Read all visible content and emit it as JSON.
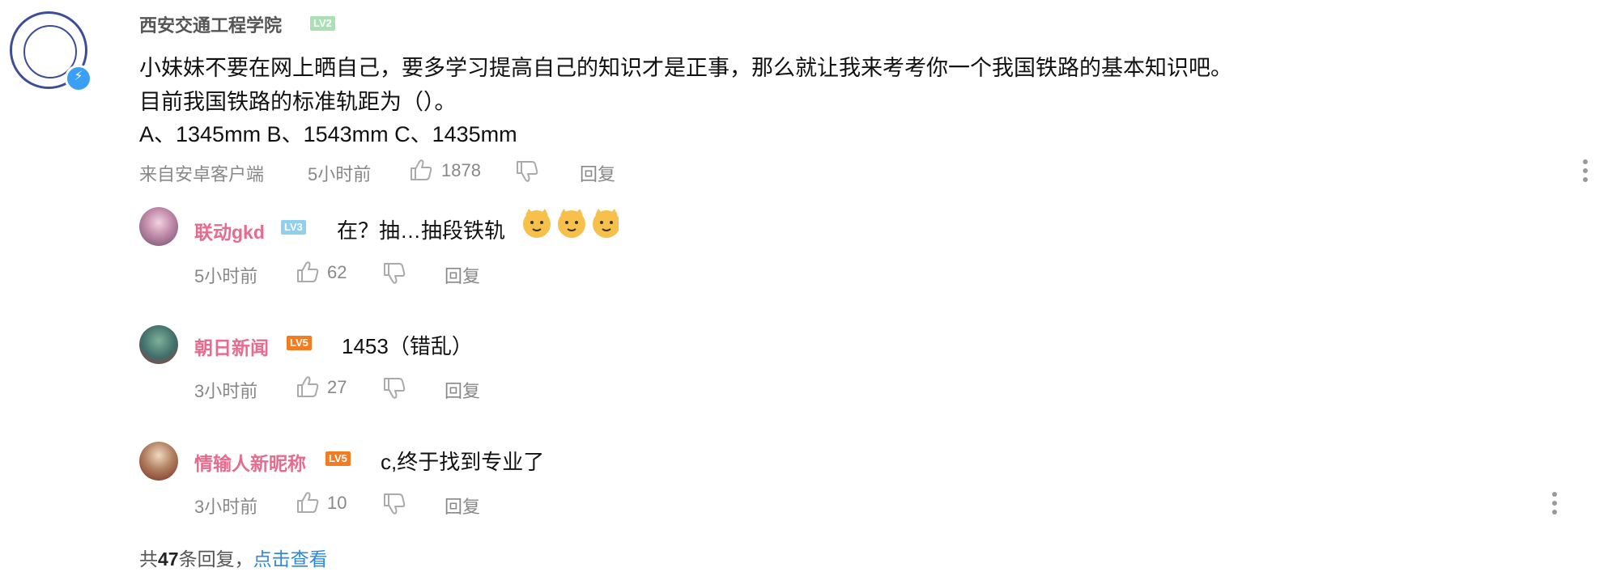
{
  "post": {
    "author": "西安交通工程学院",
    "level": "LV2",
    "lines": [
      "小妹妹不要在网上晒自己，要多学习提高自己的知识才是正事，那么就让我来考考你一个我国铁路的基本知识吧。",
      "目前我国铁路的标准轨距为（）。",
      "A、1345mm B、1543mm C、1435mm"
    ],
    "source": "来自安卓客户端",
    "time": "5小时前",
    "likes": "1878",
    "reply_label": "回复"
  },
  "replies": [
    {
      "author": "联动gkd",
      "level": "LV3",
      "level_color": "#8fd0f0",
      "text": "在？抽…抽段铁轨",
      "time": "5小时前",
      "likes": "62",
      "reply_label": "回复"
    },
    {
      "author": "朝日新闻",
      "level": "LV5",
      "level_color": "#f47c20",
      "text": "1453（错乱）",
      "time": "3小时前",
      "likes": "27",
      "reply_label": "回复"
    },
    {
      "author": "情输人新昵称",
      "level": "LV5",
      "level_color": "#f47c20",
      "text": "c,终于找到专业了",
      "time": "3小时前",
      "likes": "10",
      "reply_label": "回复"
    }
  ],
  "footer": {
    "prefix": "共",
    "count": "47",
    "suffix": "条回复，",
    "link": "点击查看"
  },
  "colors": {
    "name_pink": "#e76b8e",
    "link_blue": "#2b8ae0",
    "meta_gray": "#888888"
  }
}
